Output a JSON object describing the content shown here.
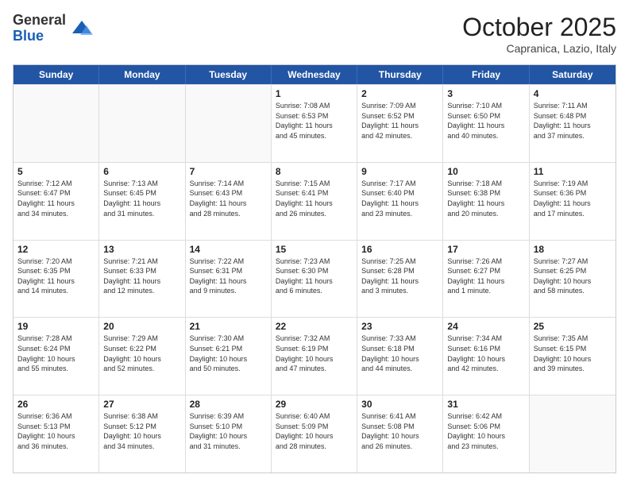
{
  "logo": {
    "general": "General",
    "blue": "Blue"
  },
  "header": {
    "month": "October 2025",
    "location": "Capranica, Lazio, Italy"
  },
  "weekdays": [
    "Sunday",
    "Monday",
    "Tuesday",
    "Wednesday",
    "Thursday",
    "Friday",
    "Saturday"
  ],
  "weeks": [
    [
      {
        "day": "",
        "info": ""
      },
      {
        "day": "",
        "info": ""
      },
      {
        "day": "",
        "info": ""
      },
      {
        "day": "1",
        "info": "Sunrise: 7:08 AM\nSunset: 6:53 PM\nDaylight: 11 hours\nand 45 minutes."
      },
      {
        "day": "2",
        "info": "Sunrise: 7:09 AM\nSunset: 6:52 PM\nDaylight: 11 hours\nand 42 minutes."
      },
      {
        "day": "3",
        "info": "Sunrise: 7:10 AM\nSunset: 6:50 PM\nDaylight: 11 hours\nand 40 minutes."
      },
      {
        "day": "4",
        "info": "Sunrise: 7:11 AM\nSunset: 6:48 PM\nDaylight: 11 hours\nand 37 minutes."
      }
    ],
    [
      {
        "day": "5",
        "info": "Sunrise: 7:12 AM\nSunset: 6:47 PM\nDaylight: 11 hours\nand 34 minutes."
      },
      {
        "day": "6",
        "info": "Sunrise: 7:13 AM\nSunset: 6:45 PM\nDaylight: 11 hours\nand 31 minutes."
      },
      {
        "day": "7",
        "info": "Sunrise: 7:14 AM\nSunset: 6:43 PM\nDaylight: 11 hours\nand 28 minutes."
      },
      {
        "day": "8",
        "info": "Sunrise: 7:15 AM\nSunset: 6:41 PM\nDaylight: 11 hours\nand 26 minutes."
      },
      {
        "day": "9",
        "info": "Sunrise: 7:17 AM\nSunset: 6:40 PM\nDaylight: 11 hours\nand 23 minutes."
      },
      {
        "day": "10",
        "info": "Sunrise: 7:18 AM\nSunset: 6:38 PM\nDaylight: 11 hours\nand 20 minutes."
      },
      {
        "day": "11",
        "info": "Sunrise: 7:19 AM\nSunset: 6:36 PM\nDaylight: 11 hours\nand 17 minutes."
      }
    ],
    [
      {
        "day": "12",
        "info": "Sunrise: 7:20 AM\nSunset: 6:35 PM\nDaylight: 11 hours\nand 14 minutes."
      },
      {
        "day": "13",
        "info": "Sunrise: 7:21 AM\nSunset: 6:33 PM\nDaylight: 11 hours\nand 12 minutes."
      },
      {
        "day": "14",
        "info": "Sunrise: 7:22 AM\nSunset: 6:31 PM\nDaylight: 11 hours\nand 9 minutes."
      },
      {
        "day": "15",
        "info": "Sunrise: 7:23 AM\nSunset: 6:30 PM\nDaylight: 11 hours\nand 6 minutes."
      },
      {
        "day": "16",
        "info": "Sunrise: 7:25 AM\nSunset: 6:28 PM\nDaylight: 11 hours\nand 3 minutes."
      },
      {
        "day": "17",
        "info": "Sunrise: 7:26 AM\nSunset: 6:27 PM\nDaylight: 11 hours\nand 1 minute."
      },
      {
        "day": "18",
        "info": "Sunrise: 7:27 AM\nSunset: 6:25 PM\nDaylight: 10 hours\nand 58 minutes."
      }
    ],
    [
      {
        "day": "19",
        "info": "Sunrise: 7:28 AM\nSunset: 6:24 PM\nDaylight: 10 hours\nand 55 minutes."
      },
      {
        "day": "20",
        "info": "Sunrise: 7:29 AM\nSunset: 6:22 PM\nDaylight: 10 hours\nand 52 minutes."
      },
      {
        "day": "21",
        "info": "Sunrise: 7:30 AM\nSunset: 6:21 PM\nDaylight: 10 hours\nand 50 minutes."
      },
      {
        "day": "22",
        "info": "Sunrise: 7:32 AM\nSunset: 6:19 PM\nDaylight: 10 hours\nand 47 minutes."
      },
      {
        "day": "23",
        "info": "Sunrise: 7:33 AM\nSunset: 6:18 PM\nDaylight: 10 hours\nand 44 minutes."
      },
      {
        "day": "24",
        "info": "Sunrise: 7:34 AM\nSunset: 6:16 PM\nDaylight: 10 hours\nand 42 minutes."
      },
      {
        "day": "25",
        "info": "Sunrise: 7:35 AM\nSunset: 6:15 PM\nDaylight: 10 hours\nand 39 minutes."
      }
    ],
    [
      {
        "day": "26",
        "info": "Sunrise: 6:36 AM\nSunset: 5:13 PM\nDaylight: 10 hours\nand 36 minutes."
      },
      {
        "day": "27",
        "info": "Sunrise: 6:38 AM\nSunset: 5:12 PM\nDaylight: 10 hours\nand 34 minutes."
      },
      {
        "day": "28",
        "info": "Sunrise: 6:39 AM\nSunset: 5:10 PM\nDaylight: 10 hours\nand 31 minutes."
      },
      {
        "day": "29",
        "info": "Sunrise: 6:40 AM\nSunset: 5:09 PM\nDaylight: 10 hours\nand 28 minutes."
      },
      {
        "day": "30",
        "info": "Sunrise: 6:41 AM\nSunset: 5:08 PM\nDaylight: 10 hours\nand 26 minutes."
      },
      {
        "day": "31",
        "info": "Sunrise: 6:42 AM\nSunset: 5:06 PM\nDaylight: 10 hours\nand 23 minutes."
      },
      {
        "day": "",
        "info": ""
      }
    ]
  ]
}
